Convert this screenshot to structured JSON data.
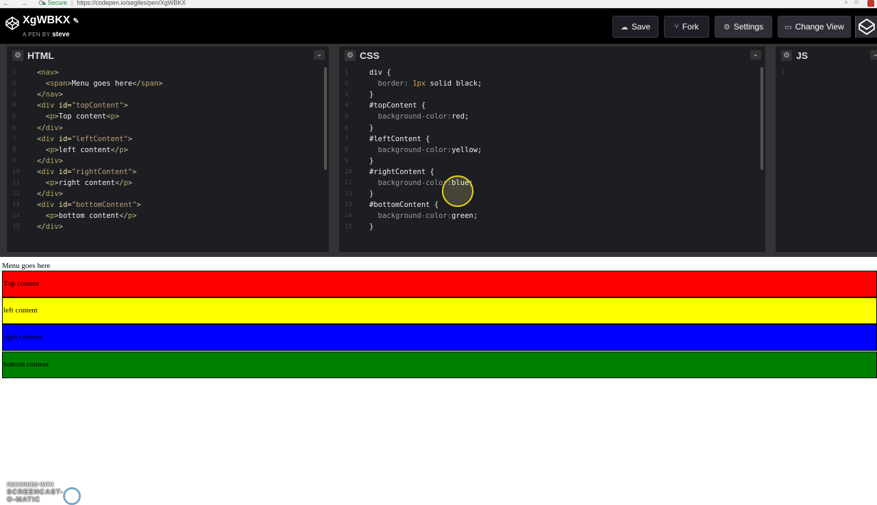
{
  "browser": {
    "nav_glyphs": "← → ⟳",
    "secure_label": "Secure",
    "url": "https://codepen.io/segiles/pen/XgWBKX"
  },
  "header": {
    "pen_title": "XgWBKX",
    "pen_by_prefix": "A PEN BY",
    "author": "steve",
    "buttons": {
      "save": "Save",
      "fork": "Fork",
      "settings": "Settings",
      "change_view": "Change View"
    }
  },
  "panels": {
    "html": {
      "title": "HTML",
      "lines": [
        {
          "n": "1",
          "parts": [
            [
              "tag",
              "<"
            ],
            [
              "tagname",
              "nav"
            ],
            [
              "tag",
              ">"
            ]
          ]
        },
        {
          "n": "2",
          "parts": [
            [
              "tag",
              "  <"
            ],
            [
              "tagname",
              "span"
            ],
            [
              "tag",
              ">"
            ],
            [
              "txt",
              "Menu goes here"
            ],
            [
              "tag",
              "</"
            ],
            [
              "tagname",
              "span"
            ],
            [
              "tag",
              ">"
            ]
          ]
        },
        {
          "n": "3",
          "parts": [
            [
              "tag",
              "</"
            ],
            [
              "tagname",
              "nav"
            ],
            [
              "tag",
              ">"
            ]
          ]
        },
        {
          "n": "4",
          "parts": [
            [
              "tag",
              "<"
            ],
            [
              "tagname",
              "div"
            ],
            [
              "attr",
              " id="
            ],
            [
              "val",
              "\"topContent\""
            ],
            [
              "tag",
              ">"
            ]
          ]
        },
        {
          "n": "5",
          "parts": [
            [
              "tag",
              "  <"
            ],
            [
              "tagname",
              "p"
            ],
            [
              "tag",
              ">"
            ],
            [
              "txt",
              "Top content"
            ],
            [
              "tag",
              "<"
            ],
            [
              "tagname",
              "p"
            ],
            [
              "tag",
              ">"
            ]
          ]
        },
        {
          "n": "6",
          "parts": [
            [
              "tag",
              "</"
            ],
            [
              "tagname",
              "div"
            ],
            [
              "tag",
              ">"
            ]
          ]
        },
        {
          "n": "7",
          "parts": [
            [
              "tag",
              "<"
            ],
            [
              "tagname",
              "div"
            ],
            [
              "attr",
              " id="
            ],
            [
              "val",
              "\"leftContent\""
            ],
            [
              "tag",
              ">"
            ]
          ]
        },
        {
          "n": "8",
          "parts": [
            [
              "tag",
              "  <"
            ],
            [
              "tagname",
              "p"
            ],
            [
              "tag",
              ">"
            ],
            [
              "txt",
              "left content"
            ],
            [
              "tag",
              "</"
            ],
            [
              "tagname",
              "p"
            ],
            [
              "tag",
              ">"
            ]
          ]
        },
        {
          "n": "9",
          "parts": [
            [
              "tag",
              "</"
            ],
            [
              "tagname",
              "div"
            ],
            [
              "tag",
              ">"
            ]
          ]
        },
        {
          "n": "10",
          "parts": [
            [
              "tag",
              "<"
            ],
            [
              "tagname",
              "div"
            ],
            [
              "attr",
              " id="
            ],
            [
              "val",
              "\"rightContent\""
            ],
            [
              "tag",
              ">"
            ]
          ]
        },
        {
          "n": "11",
          "parts": [
            [
              "tag",
              "  <"
            ],
            [
              "tagname",
              "p"
            ],
            [
              "tag",
              ">"
            ],
            [
              "txt",
              "right content"
            ],
            [
              "tag",
              "</"
            ],
            [
              "tagname",
              "p"
            ],
            [
              "tag",
              ">"
            ]
          ]
        },
        {
          "n": "12",
          "parts": [
            [
              "tag",
              "</"
            ],
            [
              "tagname",
              "div"
            ],
            [
              "tag",
              ">"
            ]
          ]
        },
        {
          "n": "13",
          "parts": [
            [
              "tag",
              "<"
            ],
            [
              "tagname",
              "div"
            ],
            [
              "attr",
              " id="
            ],
            [
              "val",
              "\"bottomContent\""
            ],
            [
              "tag",
              ">"
            ]
          ]
        },
        {
          "n": "14",
          "parts": [
            [
              "tag",
              "  <"
            ],
            [
              "tagname",
              "p"
            ],
            [
              "tag",
              ">"
            ],
            [
              "txt",
              "bottom content"
            ],
            [
              "tag",
              "</"
            ],
            [
              "tagname",
              "p"
            ],
            [
              "tag",
              ">"
            ]
          ]
        },
        {
          "n": "15",
          "parts": [
            [
              "tag",
              "</"
            ],
            [
              "tagname",
              "div"
            ],
            [
              "tag",
              ">"
            ]
          ]
        }
      ]
    },
    "css": {
      "title": "CSS",
      "lines": [
        {
          "n": "1",
          "parts": [
            [
              "sel",
              "div {"
            ]
          ]
        },
        {
          "n": "2",
          "parts": [
            [
              "prop",
              "  border: "
            ],
            [
              "num",
              "1px"
            ],
            [
              "cval",
              " solid black;"
            ]
          ]
        },
        {
          "n": "3",
          "parts": [
            [
              "sel",
              "}"
            ]
          ]
        },
        {
          "n": "4",
          "parts": [
            [
              "sel",
              "#topContent {"
            ]
          ]
        },
        {
          "n": "5",
          "parts": [
            [
              "prop",
              "  background-color:"
            ],
            [
              "cval",
              "red;"
            ]
          ]
        },
        {
          "n": "6",
          "parts": [
            [
              "sel",
              "}"
            ]
          ]
        },
        {
          "n": "7",
          "parts": [
            [
              "sel",
              "#leftContent {"
            ]
          ]
        },
        {
          "n": "8",
          "parts": [
            [
              "prop",
              "  background-color:"
            ],
            [
              "cval",
              "yellow;"
            ]
          ]
        },
        {
          "n": "9",
          "parts": [
            [
              "sel",
              "}"
            ]
          ]
        },
        {
          "n": "10",
          "parts": [
            [
              "sel",
              "#rightContent {"
            ]
          ]
        },
        {
          "n": "11",
          "parts": [
            [
              "prop",
              "  background-color:"
            ],
            [
              "cval",
              "blue;"
            ]
          ]
        },
        {
          "n": "12",
          "parts": [
            [
              "sel",
              "}"
            ]
          ]
        },
        {
          "n": "13",
          "parts": [
            [
              "sel",
              "#bottomContent {"
            ]
          ]
        },
        {
          "n": "14",
          "parts": [
            [
              "prop",
              "  background-color:"
            ],
            [
              "cval",
              "green;"
            ]
          ]
        },
        {
          "n": "15",
          "parts": [
            [
              "sel",
              "}"
            ]
          ]
        }
      ]
    },
    "js": {
      "title": "JS",
      "lines": [
        {
          "n": "1",
          "parts": []
        }
      ]
    }
  },
  "result": {
    "menu_text": "Menu goes here",
    "blocks": [
      {
        "label": "Top content",
        "color": "#ff0000"
      },
      {
        "label": "left content",
        "color": "#ffff00"
      },
      {
        "label": "right content",
        "color": "#0000ff"
      },
      {
        "label": "bottom content",
        "color": "#008000"
      }
    ]
  },
  "watermark": {
    "line1": "RECORDED WITH",
    "line2": "SCREENCAST-O-MATIC"
  },
  "colors": {
    "header_bg": "#000000",
    "editor_bg": "#1d1e22",
    "cursor_highlight": "#e8d31a"
  }
}
